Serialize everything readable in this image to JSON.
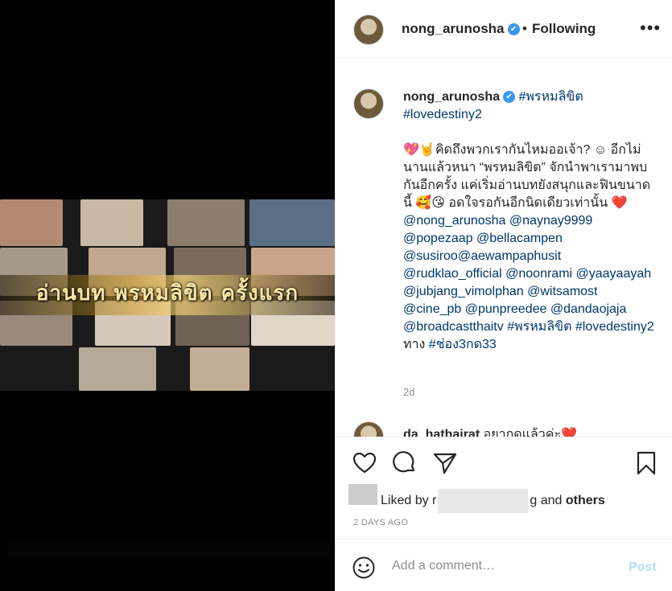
{
  "media": {
    "video_title": "อ่านบท พรหมลิขิต ครั้งแรก"
  },
  "header": {
    "username": "nong_arunosha",
    "verified_icon": "✔",
    "separator": "•",
    "following_label": "Following",
    "more_label": "•••"
  },
  "caption": {
    "username": "nong_arunosha",
    "hashtag_line": "#พรหมลิขิต #lovedestiny2",
    "emoji_lead": "💖🤘",
    "text_1": "คิดถึงพวกเรากันไหมออเจ้า? ☺ อีกไม่นานแล้วหนา “พรหมลิขิต” จักนำพาเรามาพบกันอีกครั้ง แค่เริ่มอ่านบทยังสนุกและฟินขนาดนี้ 🥰😘 อดใจรอกันอีกนิดเดียวเท่านั้น ❤️ ",
    "mentions": "@nong_arunosha @naynay9999 @popezaap @bellacampen @susiroo@aewampaphusit @rudklao_official @noonrami @yaayaayah @jubjang_vimolphan @witsamost @cine_pb @punpreedee @dandaojaja @broadcastthaitv #พรหมลิขิต #lovedestiny2",
    "text_2": " ทาง ",
    "channel_tag": "#ช่อง3กด33",
    "age": "2d"
  },
  "next_comment": {
    "username": "da_hathairat",
    "text": "อยากดูแล้วค่ะ❤️"
  },
  "actions": {
    "like_icon": "heart-icon",
    "comment_icon": "comment-icon",
    "share_icon": "share-icon",
    "save_icon": "bookmark-icon"
  },
  "likes": {
    "prefix": "Liked by",
    "name_partial_start": "r",
    "name_partial_end": "g",
    "and": "and",
    "others": "others"
  },
  "timestamp": "2 DAYS AGO",
  "comment_box": {
    "placeholder": "Add a comment…",
    "post_label": "Post"
  }
}
